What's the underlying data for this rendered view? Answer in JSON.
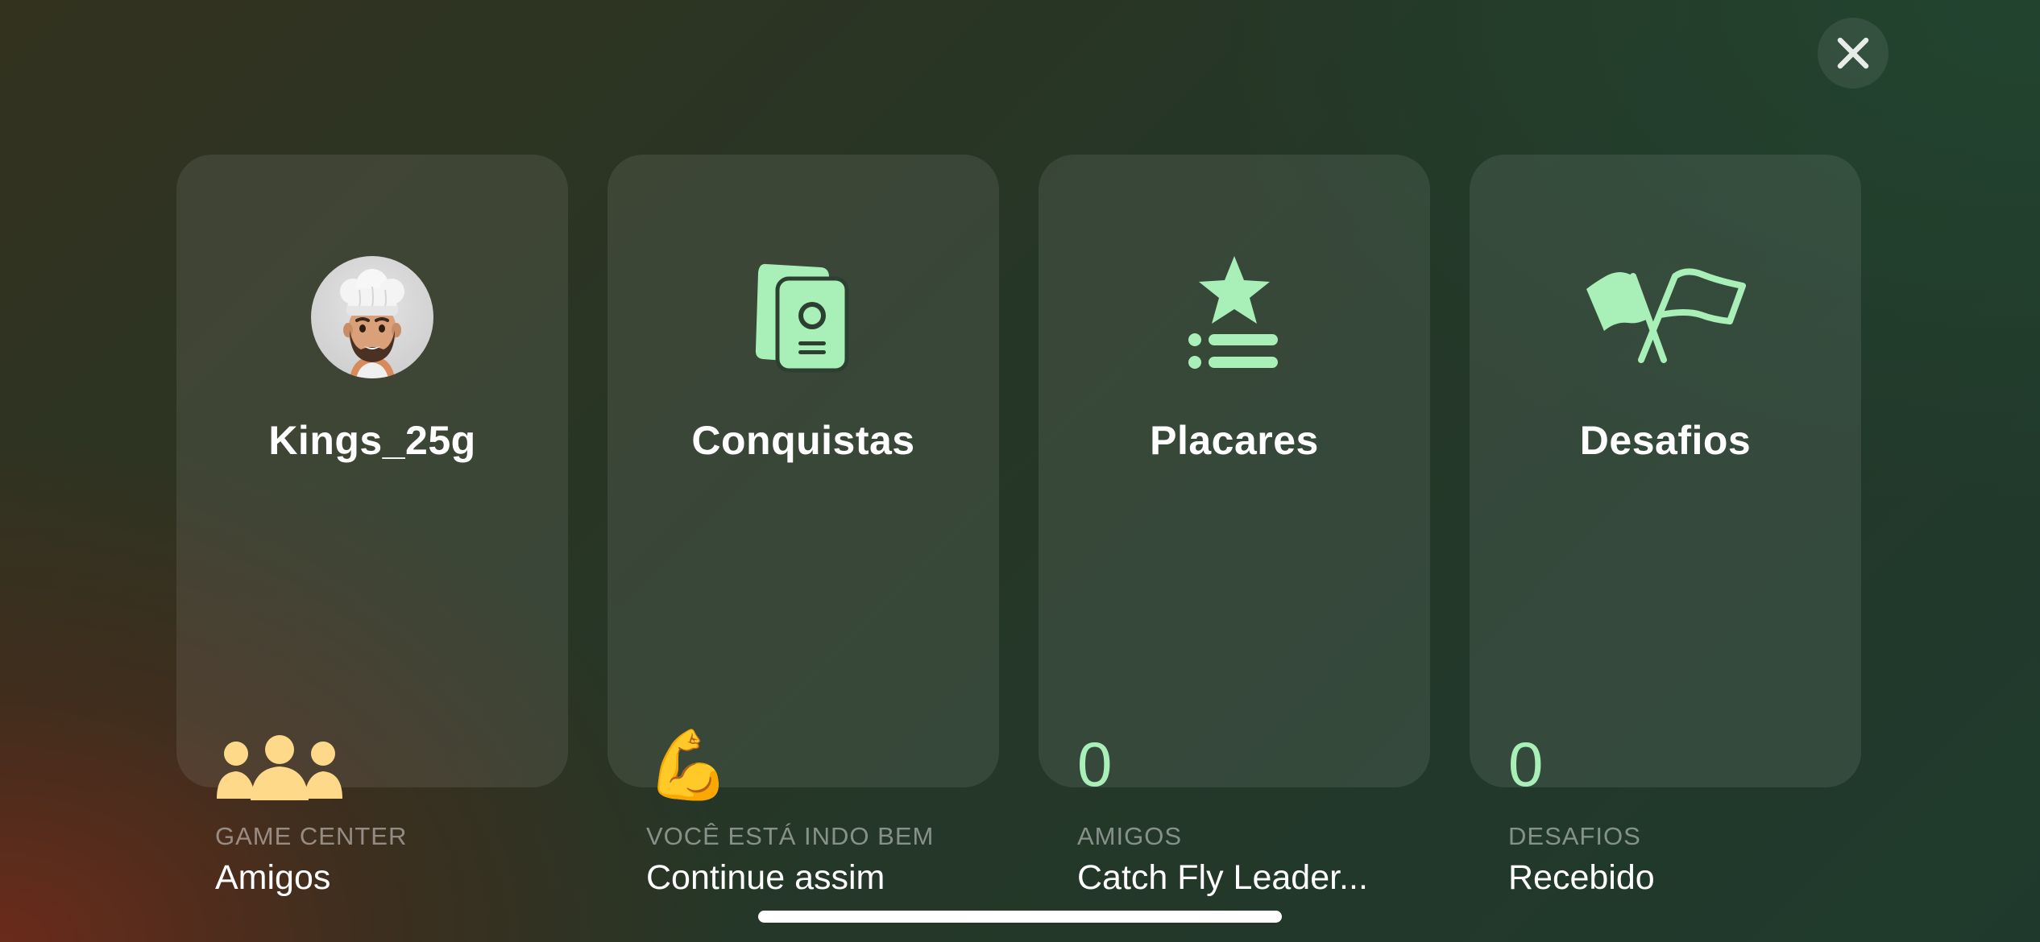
{
  "colors": {
    "accent_green": "#a8f0b8",
    "friends_yellow": "#ffd98a",
    "text_primary": "#ffffff",
    "text_caption": "rgba(255,255,255,0.45)"
  },
  "close_button": {
    "icon": "close-icon"
  },
  "cards": [
    {
      "title": "Kings_25g",
      "icon": "avatar-memoji-chef",
      "stat_icon": "friends-group-icon",
      "caption": "GAME CENTER",
      "value": "Amigos"
    },
    {
      "title": "Conquistas",
      "icon": "achievements-cards-icon",
      "stat_icon": "flexed-biceps-emoji",
      "stat_emoji": "💪",
      "caption": "VOCÊ ESTÁ INDO BEM",
      "value": "Continue assim"
    },
    {
      "title": "Placares",
      "icon": "leaderboard-star-list-icon",
      "stat_number": "0",
      "caption": "AMIGOS",
      "value": "Catch Fly Leader..."
    },
    {
      "title": "Desafios",
      "icon": "challenges-flags-icon",
      "stat_number": "0",
      "caption": "DESAFIOS",
      "value": "Recebido"
    }
  ]
}
